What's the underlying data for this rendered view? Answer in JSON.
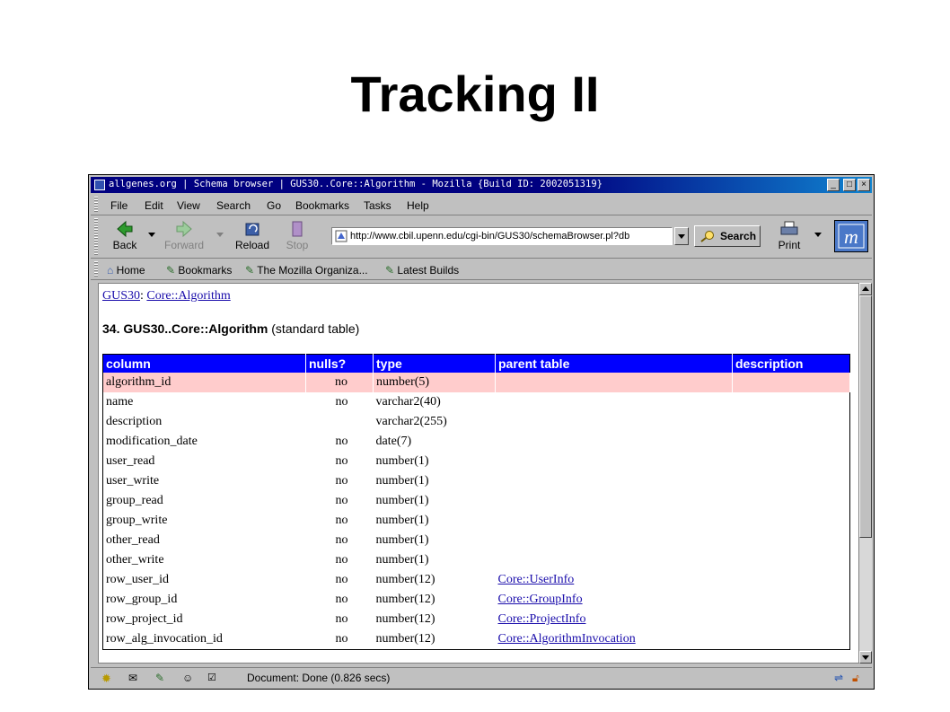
{
  "slide": {
    "title": "Tracking II"
  },
  "window": {
    "title": "allgenes.org | Schema browser | GUS30..Core::Algorithm - Mozilla {Build ID: 2002051319}",
    "buttons": [
      "minimize",
      "maximize",
      "close"
    ]
  },
  "menubar": {
    "items": [
      "File",
      "Edit",
      "View",
      "Search",
      "Go",
      "Bookmarks",
      "Tasks",
      "Help"
    ]
  },
  "navbar": {
    "back": "Back",
    "forward": "Forward",
    "reload": "Reload",
    "stop": "Stop",
    "url": "http://www.cbil.upenn.edu/cgi-bin/GUS30/schemaBrowser.pl?db",
    "search": "Search",
    "print": "Print"
  },
  "bookmarks": {
    "items": [
      "Home",
      "Bookmarks",
      "The Mozilla Organiza...",
      "Latest Builds"
    ]
  },
  "page": {
    "crumb_link1": "GUS30",
    "crumb_sep": ":",
    "crumb_link2": "Core::Algorithm",
    "heading_bold": "34. GUS30..Core::Algorithm",
    "heading_rest": "(standard table)"
  },
  "table": {
    "headers": [
      "column",
      "nulls?",
      "type",
      "parent table",
      "description"
    ],
    "rows": [
      {
        "column": "algorithm_id",
        "nulls": "no",
        "type": "number(5)",
        "parent": "",
        "desc": ""
      },
      {
        "column": "name",
        "nulls": "no",
        "type": "varchar2(40)",
        "parent": "",
        "desc": ""
      },
      {
        "column": "description",
        "nulls": "",
        "type": "varchar2(255)",
        "parent": "",
        "desc": ""
      },
      {
        "column": "modification_date",
        "nulls": "no",
        "type": "date(7)",
        "parent": "",
        "desc": ""
      },
      {
        "column": "user_read",
        "nulls": "no",
        "type": "number(1)",
        "parent": "",
        "desc": ""
      },
      {
        "column": "user_write",
        "nulls": "no",
        "type": "number(1)",
        "parent": "",
        "desc": ""
      },
      {
        "column": "group_read",
        "nulls": "no",
        "type": "number(1)",
        "parent": "",
        "desc": ""
      },
      {
        "column": "group_write",
        "nulls": "no",
        "type": "number(1)",
        "parent": "",
        "desc": ""
      },
      {
        "column": "other_read",
        "nulls": "no",
        "type": "number(1)",
        "parent": "",
        "desc": ""
      },
      {
        "column": "other_write",
        "nulls": "no",
        "type": "number(1)",
        "parent": "",
        "desc": ""
      },
      {
        "column": "row_user_id",
        "nulls": "no",
        "type": "number(12)",
        "parent": "Core::UserInfo",
        "desc": ""
      },
      {
        "column": "row_group_id",
        "nulls": "no",
        "type": "number(12)",
        "parent": "Core::GroupInfo",
        "desc": ""
      },
      {
        "column": "row_project_id",
        "nulls": "no",
        "type": "number(12)",
        "parent": "Core::ProjectInfo",
        "desc": ""
      },
      {
        "column": "row_alg_invocation_id",
        "nulls": "no",
        "type": "number(12)",
        "parent": "Core::AlgorithmInvocation",
        "desc": ""
      }
    ]
  },
  "status": {
    "text": "Document: Done (0.826 secs)"
  },
  "colors": {
    "header_bg": "#0000ff",
    "highlight_row": "#ffcccc",
    "titlebar": "#000080",
    "link": "#1a0dab"
  }
}
